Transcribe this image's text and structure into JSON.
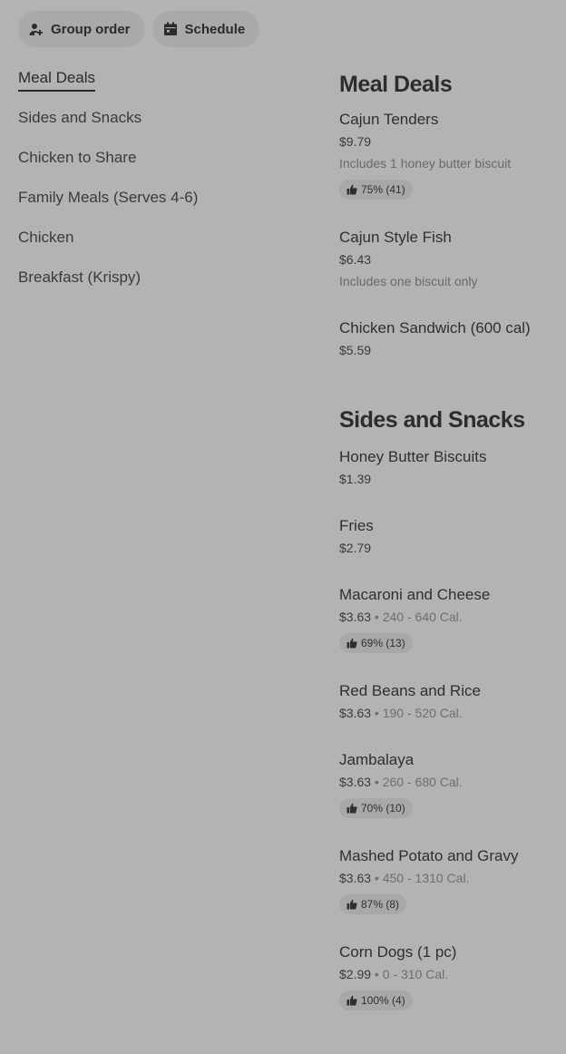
{
  "actions": {
    "group_order": "Group order",
    "schedule": "Schedule"
  },
  "sidebar": {
    "items": [
      {
        "label": "Meal Deals",
        "active": true
      },
      {
        "label": "Sides and Snacks"
      },
      {
        "label": "Chicken to Share"
      },
      {
        "label": "Family Meals (Serves 4-6)"
      },
      {
        "label": "Chicken"
      },
      {
        "label": "Breakfast (Krispy)"
      }
    ]
  },
  "sections": [
    {
      "title": "Meal Deals",
      "items": [
        {
          "name": "Cajun Tenders",
          "price": "$9.79",
          "desc": "Includes 1 honey butter biscuit",
          "rating": "75% (41)"
        },
        {
          "name": "Cajun Style Fish",
          "price": "$6.43",
          "desc": "Includes one biscuit only"
        },
        {
          "name": "Chicken Sandwich (600 cal)",
          "price": "$5.59"
        }
      ]
    },
    {
      "title": "Sides and Snacks",
      "items": [
        {
          "name": "Honey Butter Biscuits",
          "price": "$1.39"
        },
        {
          "name": "Fries",
          "price": "$2.79"
        },
        {
          "name": "Macaroni and Cheese",
          "price": "$3.63",
          "cal": " • 240 - 640 Cal.",
          "rating": "69% (13)"
        },
        {
          "name": "Red Beans and Rice",
          "price": "$3.63",
          "cal": " • 190 - 520 Cal."
        },
        {
          "name": "Jambalaya",
          "price": "$3.63",
          "cal": " • 260 - 680 Cal.",
          "rating": "70% (10)"
        },
        {
          "name": "Mashed Potato and Gravy",
          "price": "$3.63",
          "cal": " • 450 - 1310 Cal.",
          "rating": "87% (8)"
        },
        {
          "name": "Corn Dogs (1 pc)",
          "price": "$2.99",
          "cal": " • 0 - 310 Cal.",
          "rating": "100% (4)"
        }
      ]
    }
  ]
}
